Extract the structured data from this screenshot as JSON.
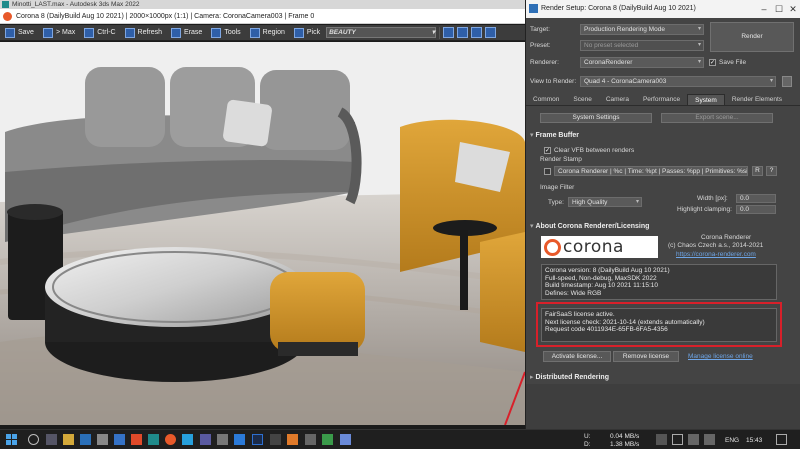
{
  "max_window": {
    "title": "Minotti_LAST.max - Autodesk 3ds Max 2022"
  },
  "vfb": {
    "title": "Corona 8 (DailyBuild Aug 10 2021) | 2000×1000px (1:1) | Camera: CoronaCamera003 | Frame 0",
    "toolbar": {
      "save": "Save",
      "to_max": "> Max",
      "ctrl_c": "Ctrl-C",
      "refresh": "Refresh",
      "erase": "Erase",
      "tools": "Tools",
      "region": "Region",
      "pick": "Pick",
      "channel": "BEAUTY"
    }
  },
  "render_setup": {
    "title": "Render Setup: Corona 8 (DailyBuild Aug 10 2021)",
    "target_label": "Target:",
    "target_value": "Production Rendering Mode",
    "preset_label": "Preset:",
    "preset_value": "No preset selected",
    "renderer_label": "Renderer:",
    "renderer_value": "CoronaRenderer",
    "save_file_label": "Save File",
    "view_label": "View to Render:",
    "view_value": "Quad 4 - CoronaCamera003",
    "render_button": "Render",
    "tabs": [
      "Common",
      "Scene",
      "Camera",
      "Performance",
      "System",
      "Render Elements"
    ],
    "system_settings_button": "System Settings",
    "export_scene_button": "Export scene...",
    "frame_buffer": {
      "header": "Frame Buffer",
      "clear_vfb_label": "Clear VFB between renders",
      "render_stamp_label": "Render Stamp",
      "render_stamp_value": "Corona Renderer | %c | Time: %pt | Passes: %pp | Primitives: %si",
      "stamp_btn_r": "R",
      "stamp_btn_q": "?",
      "image_filter_label": "Image Filter",
      "type_label": "Type:",
      "type_value": "High Quality",
      "width_label": "Width [px]:",
      "width_value": "0.0",
      "clamping_label": "Highlight clamping:",
      "clamping_value": "0.0"
    },
    "about": {
      "header": "About Corona Renderer/Licensing",
      "logo_text": "corona",
      "product_name": "Corona Renderer",
      "copyright": "(c) Chaos Czech a.s., 2014-2021",
      "website": "https://corona-renderer.com",
      "info_lines": [
        "Corona version: 8 (DailyBuild Aug 10 2021)",
        "Full-speed, Non-debug, MaxSDK 2022",
        "Build timestamp: Aug 10 2021 11:15:10",
        "Defines: Wide RGB"
      ],
      "license_lines": [
        "FairSaaS license active.",
        "Next license check: 2021-10-14 (extends automatically)",
        "Request code 4011934E-65FB-6FA5-4356"
      ],
      "activate_button": "Activate license...",
      "remove_button": "Remove license",
      "manage_link": "Manage license online"
    },
    "distributed_header": "Distributed Rendering"
  },
  "taskbar": {
    "net_up_label": "U:",
    "net_up_value": "0.04 MB/s",
    "net_down_label": "D:",
    "net_down_value": "1.38 MB/s",
    "language": "ENG",
    "time": "15:43"
  },
  "colors": {
    "highlight_box": "#d8202a",
    "arrow": "#d8202a",
    "corona_orange": "#e8592a",
    "panel_bg": "#444444"
  }
}
